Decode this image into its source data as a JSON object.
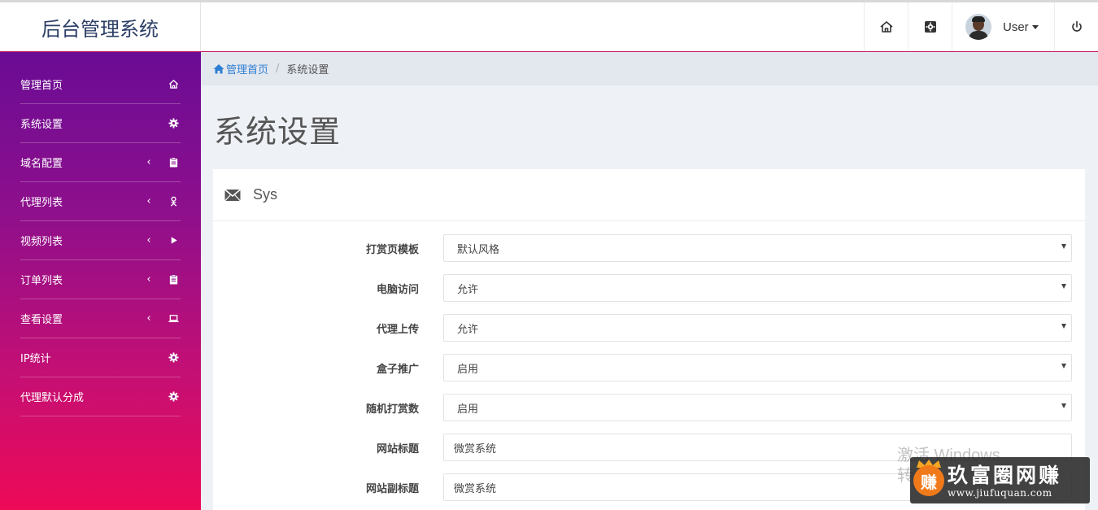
{
  "header": {
    "brand": "后台管理系统",
    "user_name": "User"
  },
  "sidebar": {
    "items": [
      {
        "label": "管理首页",
        "icon": "home-icon",
        "has_chevron": false
      },
      {
        "label": "系统设置",
        "icon": "gear-icon",
        "has_chevron": false
      },
      {
        "label": "域名配置",
        "icon": "clipboard-icon",
        "has_chevron": true
      },
      {
        "label": "代理列表",
        "icon": "user-icon",
        "has_chevron": true
      },
      {
        "label": "视频列表",
        "icon": "play-icon",
        "has_chevron": true
      },
      {
        "label": "订单列表",
        "icon": "clipboard-icon",
        "has_chevron": true
      },
      {
        "label": "查看设置",
        "icon": "laptop-icon",
        "has_chevron": true
      },
      {
        "label": "IP统计",
        "icon": "gear-icon",
        "has_chevron": false
      },
      {
        "label": "代理默认分成",
        "icon": "gear-icon",
        "has_chevron": false
      }
    ],
    "chevron_glyph": "‹"
  },
  "breadcrumb": {
    "home": "管理首页",
    "separator": "/",
    "current": "系统设置"
  },
  "main": {
    "page_title": "系统设置",
    "panel_title": "Sys",
    "form": [
      {
        "label": "打赏页模板",
        "type": "select",
        "value": "默认风格"
      },
      {
        "label": "电脑访问",
        "type": "select",
        "value": "允许"
      },
      {
        "label": "代理上传",
        "type": "select",
        "value": "允许"
      },
      {
        "label": "盒子推广",
        "type": "select",
        "value": "启用"
      },
      {
        "label": "随机打赏数",
        "type": "select",
        "value": "启用"
      },
      {
        "label": "网站标题",
        "type": "input",
        "value": "微赏系统"
      },
      {
        "label": "网站副标题",
        "type": "input",
        "value": "微赏系统"
      }
    ]
  },
  "watermarks": {
    "windows_line1": "激活 Windows",
    "windows_line2": "转",
    "logo_badge": "赚",
    "logo_text": "玖富圈网赚",
    "logo_url": "www.jiufuquan.com"
  },
  "colors": {
    "sidebar_top": "#6a0c95",
    "sidebar_bottom": "#ee0a57",
    "breadcrumb_link": "#2e7fd4"
  }
}
